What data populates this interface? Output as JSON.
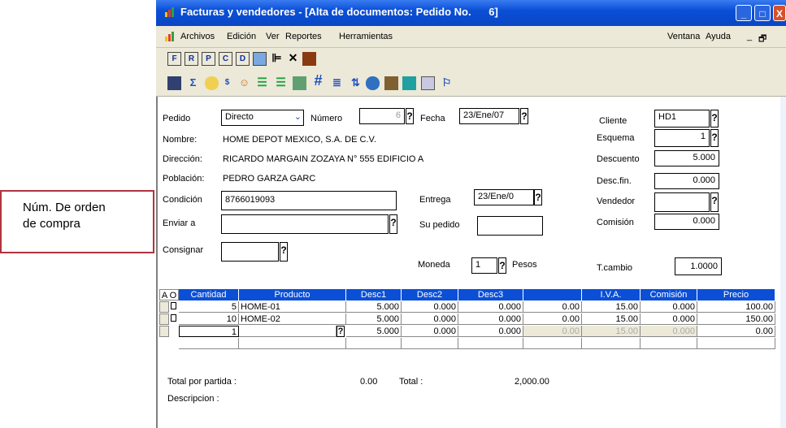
{
  "callout": {
    "line1": "Núm. De orden",
    "line2": "de compra"
  },
  "window": {
    "title": "Facturas y vendedores - [Alta de documentos: Pedido No.      6]"
  },
  "menu": {
    "items": [
      "Archivos",
      "Edición",
      "Ver",
      "Reportes",
      "Herramientas"
    ],
    "right_items": [
      "Ventana",
      "Ayuda"
    ]
  },
  "toolbar1": {
    "letters": [
      "F",
      "R",
      "P",
      "C",
      "D"
    ]
  },
  "form": {
    "pedido_label": "Pedido",
    "pedido_value": "Directo",
    "numero_label": "Número",
    "numero_value": "6",
    "fecha_label": "Fecha",
    "fecha_value": "23/Ene/07",
    "cliente_label": "Cliente",
    "cliente_value": "HD1",
    "nombre_label": "Nombre:",
    "nombre_value": "HOME DEPOT MEXICO, S.A. DE C.V.",
    "esquema_label": "Esquema",
    "esquema_value": "1",
    "direccion_label": "Dirección:",
    "direccion_value": "RICARDO MARGAIN ZOZAYA N° 555 EDIFICIO A",
    "descuento_label": "Descuento",
    "descuento_value": "5.000",
    "poblacion_label": "Población:",
    "poblacion_value": "PEDRO GARZA GARC",
    "descfin_label": "Desc.fin.",
    "descfin_value": "0.000",
    "condicion_label": "Condición",
    "condicion_value": "8766019093",
    "entrega_label": "Entrega",
    "entrega_value": "23/Ene/0",
    "vendedor_label": "Vendedor",
    "vendedor_value": "",
    "enviar_label": "Enviar a",
    "enviar_value": "",
    "supedido_label": "Su pedido",
    "supedido_value": "",
    "comision_label": "Comisión",
    "comision_value": "0.000",
    "consignar_label": "Consignar",
    "consignar_value": "",
    "moneda_label": "Moneda",
    "moneda_value": "1",
    "pesos_label": "Pesos",
    "tcambio_label": "T.cambio",
    "tcambio_value": "1.0000",
    "q": "?"
  },
  "grid": {
    "corner": "A O",
    "headers": [
      "Cantidad",
      "Producto",
      "Desc1",
      "Desc2",
      "Desc3",
      "",
      "I.V.A.",
      "Comisión",
      "Precio"
    ],
    "rows": [
      [
        "5",
        "HOME-01",
        "5.000",
        "0.000",
        "0.000",
        "0.00",
        "15.00",
        "0.000",
        "100.00"
      ],
      [
        "10",
        "HOME-02",
        "5.000",
        "0.000",
        "0.000",
        "0.00",
        "15.00",
        "0.000",
        "150.00"
      ],
      [
        "1",
        "",
        "5.000",
        "0.000",
        "0.000",
        "0.00",
        "15.00",
        "0.000",
        "0.00"
      ]
    ]
  },
  "footer": {
    "total_partida_label": "Total por partida :",
    "total_partida_value": "0.00",
    "total_label": "Total  :",
    "total_value": "2,000.00",
    "descripcion_label": "Descripcion :"
  },
  "colors": {
    "accent": "#b0343f",
    "titlebar": "#0a4fd6"
  }
}
